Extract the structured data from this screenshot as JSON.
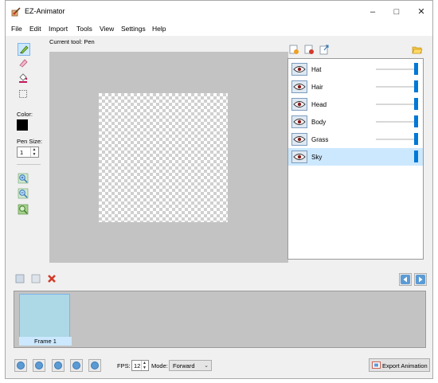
{
  "window": {
    "title": "EZ-Animator",
    "icons": {
      "app": "app-paintbrush-icon",
      "minimize": "minimize-icon",
      "maximize": "maximize-icon",
      "close": "close-icon"
    }
  },
  "menu": [
    "File",
    "Edit",
    "Import",
    "Tools",
    "View",
    "Settings",
    "Help"
  ],
  "toolbox": {
    "tools": [
      {
        "name": "pen-icon",
        "selected": true
      },
      {
        "name": "eraser-icon",
        "selected": false
      },
      {
        "name": "fill-bucket-icon",
        "selected": false
      },
      {
        "name": "selection-icon",
        "selected": false
      }
    ],
    "color_label": "Color:",
    "color_value": "#000000",
    "pen_size_label": "Pen Size:",
    "pen_size_value": "1",
    "zoom_tools": [
      "zoom-in-icon",
      "zoom-out-icon",
      "zoom-reset-icon"
    ]
  },
  "canvas": {
    "current_tool_label": "Current tool: Pen",
    "background_color": "#c3c3c3"
  },
  "layers": {
    "toolbar_icons": [
      "add-layer-icon",
      "delete-layer-icon",
      "export-layer-icon",
      "open-folder-icon"
    ],
    "items": [
      {
        "name": "Hat",
        "opacity": 1.0,
        "selected": false
      },
      {
        "name": "Hair",
        "opacity": 1.0,
        "selected": false
      },
      {
        "name": "Head",
        "opacity": 1.0,
        "selected": false
      },
      {
        "name": "Body",
        "opacity": 1.0,
        "selected": false
      },
      {
        "name": "Grass",
        "opacity": 1.0,
        "selected": false
      },
      {
        "name": "Sky",
        "opacity": 1.0,
        "selected": true
      }
    ]
  },
  "frames": {
    "toolbar_icons": [
      "add-frame-icon",
      "duplicate-frame-icon",
      "delete-frame-icon"
    ],
    "nav_icons": [
      "previous-frame-icon",
      "next-frame-icon"
    ],
    "items": [
      {
        "label": "Frame 1",
        "color": "#add8e6"
      }
    ]
  },
  "playback": {
    "buttons": [
      "first-frame-icon",
      "step-back-icon",
      "play-icon",
      "step-forward-icon",
      "last-frame-icon"
    ],
    "fps_label": "FPS:",
    "fps_value": "12",
    "mode_label": "Mode:",
    "mode_value": "Forward",
    "export_label": "Export Animation"
  },
  "colors": {
    "accent": "#0078d7",
    "selection": "#cce8ff",
    "delete_red": "#d23a2a"
  }
}
